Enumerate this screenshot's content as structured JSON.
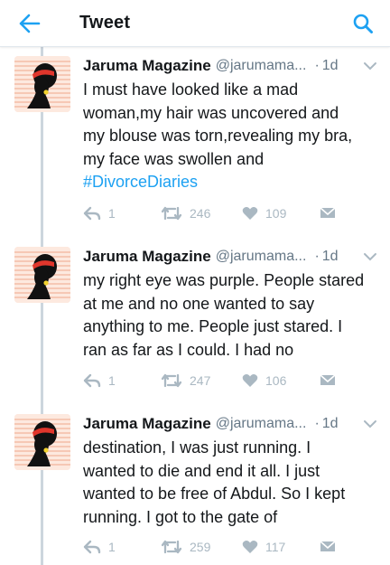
{
  "header": {
    "title": "Tweet",
    "back_icon": "arrow-left-icon",
    "search_icon": "search-icon"
  },
  "colors": {
    "accent": "#1da1f2",
    "text": "#14171a",
    "secondary": "#657786",
    "muted": "#aab8c2",
    "thread_line": "#ccd6dd"
  },
  "tweets": [
    {
      "author": {
        "name": "Jaruma Magazine",
        "handle": "@jarumama...",
        "avatar_icon": "woman-silhouette-logo-icon"
      },
      "separator": "·",
      "time": "1d",
      "text_lines": [
        "I must have looked like a mad",
        "woman,my hair was uncovered and",
        "my blouse was torn,revealing my bra,",
        "my face was swollen and"
      ],
      "hashtag": "#DivorceDiaries",
      "replies": "1",
      "retweets": "246",
      "likes": "109"
    },
    {
      "author": {
        "name": "Jaruma Magazine",
        "handle": "@jarumama...",
        "avatar_icon": "woman-silhouette-logo-icon"
      },
      "separator": "·",
      "time": "1d",
      "text_lines": [
        "my right eye was purple. People stared",
        "at me and no one wanted to say",
        "anything to me. People just stared. I",
        "ran as far as I could. I had no"
      ],
      "replies": "1",
      "retweets": "247",
      "likes": "106"
    },
    {
      "author": {
        "name": "Jaruma Magazine",
        "handle": "@jarumama...",
        "avatar_icon": "woman-silhouette-logo-icon"
      },
      "separator": "·",
      "time": "1d",
      "text_lines": [
        "destination, I was just running. I",
        "wanted to die and end it all. I just",
        "wanted to be free of Abdul. So I kept",
        "running. I got to the gate of"
      ],
      "replies": "1",
      "retweets": "259",
      "likes": "117"
    }
  ]
}
